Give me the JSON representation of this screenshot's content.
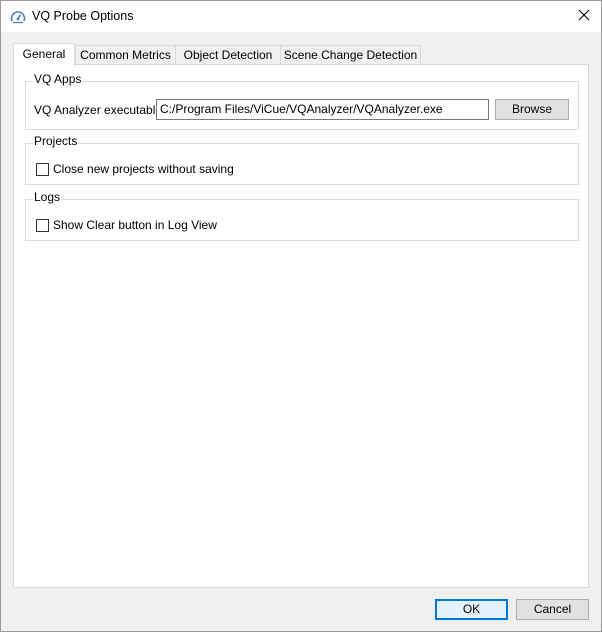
{
  "window": {
    "title": "VQ Probe Options"
  },
  "tabs": [
    {
      "label": "General",
      "active": true
    },
    {
      "label": "Common Metrics",
      "active": false
    },
    {
      "label": "Object Detection",
      "active": false
    },
    {
      "label": "Scene Change Detection",
      "active": false
    }
  ],
  "general": {
    "vq_apps": {
      "title": "VQ Apps",
      "analyzer_label": "VQ Analyzer executable",
      "analyzer_path": "C:/Program Files/ViCue/VQAnalyzer/VQAnalyzer.exe",
      "browse_label": "Browse"
    },
    "projects": {
      "title": "Projects",
      "close_without_saving_label": "Close new projects without saving",
      "close_without_saving_checked": false
    },
    "logs": {
      "title": "Logs",
      "show_clear_label": "Show Clear button in Log View",
      "show_clear_checked": false
    }
  },
  "footer": {
    "ok_label": "OK",
    "cancel_label": "Cancel"
  },
  "colors": {
    "accent": "#0078d7",
    "icon": "#4a7ab8"
  },
  "icons": {
    "app": "speedometer-icon",
    "close": "close-icon"
  }
}
